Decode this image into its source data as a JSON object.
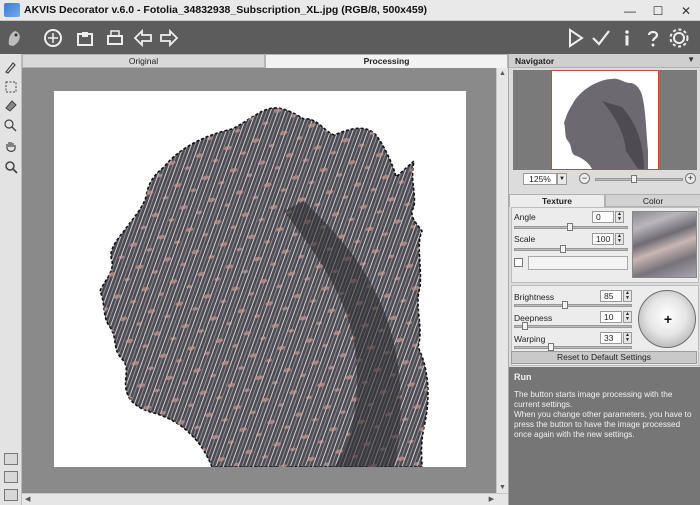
{
  "window": {
    "title": "AKVIS Decorator v.6.0 - Fotolia_34832938_Subscription_XL.jpg (RGB/8, 500x459)",
    "minimize": "—",
    "maximize": "☐",
    "close": "✕"
  },
  "toolbar": {
    "left_icons": [
      "app-logo-icon",
      "open-icon",
      "save-icon",
      "print-icon",
      "undo-icon",
      "redo-icon"
    ],
    "right_icons": [
      "run-icon",
      "apply-icon",
      "info-icon",
      "help-icon",
      "settings-icon"
    ]
  },
  "tools": [
    "brush-icon",
    "rect-select-icon",
    "eraser-icon",
    "magic-icon",
    "hand-icon",
    "zoom-icon"
  ],
  "view_tabs": [
    {
      "label": "Original"
    },
    {
      "label": "Processing"
    }
  ],
  "navigator": {
    "title": "Navigator",
    "zoom": "125%"
  },
  "param_tabs": [
    {
      "label": "Texture"
    },
    {
      "label": "Color"
    }
  ],
  "params": {
    "angle_label": "Angle",
    "angle_value": "0",
    "scale_label": "Scale",
    "scale_value": "100",
    "brightness_label": "Brightness",
    "brightness_value": "85",
    "deepness_label": "Deepness",
    "deepness_value": "10",
    "warping_label": "Warping",
    "warping_value": "33",
    "dial_symbol": "+",
    "reset_label": "Reset to Default Settings"
  },
  "help": {
    "title": "Run",
    "line1": "The button starts image processing with the current settings.",
    "line2": "When you change other parameters, you have to press the button to have the image processed once again with the new settings."
  }
}
